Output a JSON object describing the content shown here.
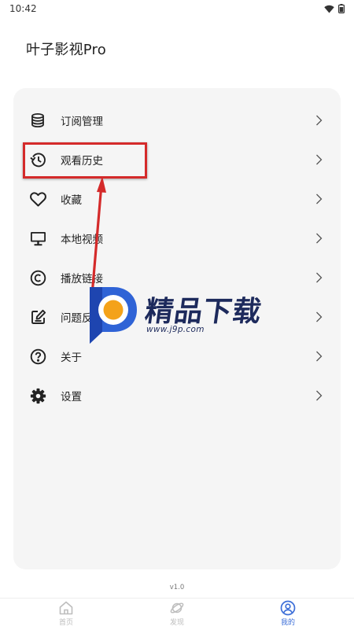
{
  "status_bar": {
    "time": "10:42"
  },
  "app": {
    "title": "叶子影视Pro"
  },
  "menu": {
    "items": [
      {
        "label": "订阅管理",
        "icon": "database-icon"
      },
      {
        "label": "观看历史",
        "icon": "history-icon"
      },
      {
        "label": "收藏",
        "icon": "heart-icon"
      },
      {
        "label": "本地视频",
        "icon": "monitor-icon"
      },
      {
        "label": "播放链接",
        "icon": "copyright-icon"
      },
      {
        "label": "问题反馈",
        "icon": "edit-note-icon"
      },
      {
        "label": "关于",
        "icon": "help-circle-icon"
      },
      {
        "label": "设置",
        "icon": "gear-icon"
      }
    ]
  },
  "annotation": {
    "color": "#d42a2a"
  },
  "watermark": {
    "title": "精品下载",
    "url": "www.j9p.com"
  },
  "footer": {
    "version": "v1.0"
  },
  "bottom_nav": {
    "items": [
      {
        "label": "首页",
        "icon": "home-icon",
        "active": false
      },
      {
        "label": "发现",
        "icon": "planet-icon",
        "active": false
      },
      {
        "label": "我的",
        "icon": "user-icon",
        "active": true
      }
    ],
    "active_color": "#3d6fd8",
    "inactive_color": "#bdbdbd"
  }
}
